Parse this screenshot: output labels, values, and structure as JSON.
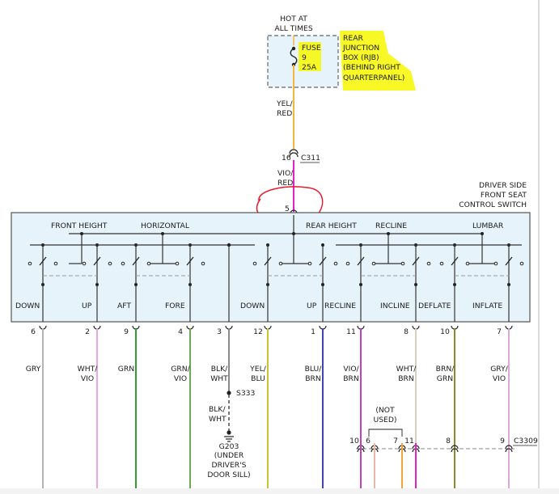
{
  "power": {
    "source_line1": "HOT AT",
    "source_line2": "ALL TIMES",
    "fuse_label": "FUSE",
    "fuse_number": "9",
    "fuse_rating": "25A",
    "rjb_lines": [
      "REAR",
      "JUNCTION",
      "BOX (RJB)",
      "(BEHIND RIGHT",
      "QUARTERPANEL)"
    ],
    "feed_wire_color": [
      "YEL/",
      "RED"
    ],
    "connector_pin": "16",
    "connector_name": "C311",
    "switch_wire_color": [
      "VIO/",
      "RED"
    ],
    "switch_pin": "5"
  },
  "switch": {
    "title_lines": [
      "DRIVER SIDE",
      "FRONT SEAT",
      "CONTROL SWITCH"
    ],
    "groups": [
      {
        "label": "FRONT HEIGHT",
        "left": "DOWN",
        "right": "UP"
      },
      {
        "label": "HORIZONTAL",
        "left": "AFT",
        "right": "FORE"
      },
      {
        "label": "REAR HEIGHT",
        "left": "DOWN",
        "right": "UP"
      },
      {
        "label": "RECLINE",
        "left": "RECLINE",
        "right": "INCLINE"
      },
      {
        "label": "LUMBAR",
        "left": "DEFLATE",
        "right": "INFLATE"
      }
    ]
  },
  "pins": [
    {
      "pin": "6",
      "color_lines": [
        "GRY"
      ],
      "hex": "#b4b4b4"
    },
    {
      "pin": "2",
      "color_lines": [
        "WHT/",
        "VIO"
      ],
      "hex": "#e9a7e9"
    },
    {
      "pin": "9",
      "color_lines": [
        "GRN"
      ],
      "hex": "#2fa12f"
    },
    {
      "pin": "4",
      "color_lines": [
        "GRN/",
        "VIO"
      ],
      "hex": "#6fa65a"
    },
    {
      "pin": "3",
      "color_lines": [
        "BLK/",
        "WHT"
      ],
      "hex": "#8a8a8a"
    },
    {
      "pin": "12",
      "color_lines": [
        "YEL/",
        "BLU"
      ],
      "hex": "#c9c23a"
    },
    {
      "pin": "1",
      "color_lines": [
        "BLU/",
        "BRN"
      ],
      "hex": "#4444b0"
    },
    {
      "pin": "11",
      "color_lines": [
        "VIO/",
        "BRN"
      ],
      "hex": "#c040c0"
    },
    {
      "pin": "8",
      "color_lines": [
        "WHT/",
        "BRN"
      ],
      "hex": "#d9cfc0"
    },
    {
      "pin": "10",
      "color_lines": [
        "BRN/",
        "GRN"
      ],
      "hex": "#8a8a2a"
    },
    {
      "pin": "7",
      "color_lines": [
        "GRY/",
        "VIO"
      ],
      "hex": "#d8a8d8"
    }
  ],
  "ground": {
    "splice": "S333",
    "wire_color": [
      "BLK/",
      "WHT"
    ],
    "name": "G203",
    "location_lines": [
      "(UNDER",
      "DRIVER'S",
      "DOOR SILL)"
    ]
  },
  "lower_connector": {
    "name": "C3309",
    "pins": [
      "10",
      "6",
      "7",
      "11",
      "8",
      "9"
    ],
    "not_used_lines": [
      "(NOT",
      "USED)"
    ]
  },
  "colors": {
    "highlight": "#f7f700",
    "annotation": "#e8192c",
    "box_fill": "#e6f3fb",
    "feed_wire": "#f4b63c",
    "switch_wire": "#e020c8",
    "orange_wire": "#f2a33a"
  }
}
